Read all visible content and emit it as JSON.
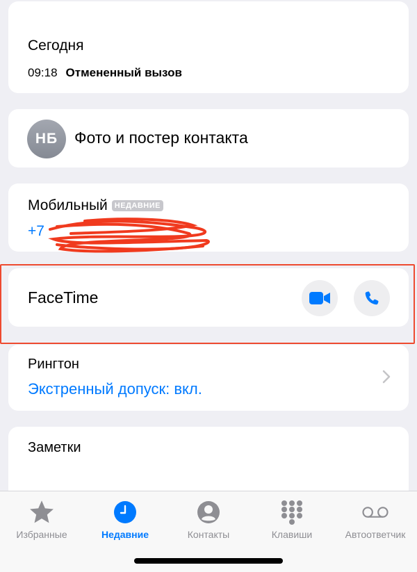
{
  "recent": {
    "date": "Сегодня",
    "time": "09:18",
    "type": "Отмененный вызов"
  },
  "contact": {
    "initials": "НБ",
    "photo_label": "Фото и постер контакта"
  },
  "mobile": {
    "label": "Мобильный",
    "badge": "НЕДАВНИЕ",
    "number": "+7"
  },
  "facetime": {
    "label": "FaceTime",
    "video_icon": "video-camera-icon",
    "audio_icon": "phone-icon"
  },
  "ringtone": {
    "label": "Рингтон",
    "value": "Экстренный допуск: вкл."
  },
  "notes": {
    "label": "Заметки"
  },
  "tabbar": {
    "tabs": [
      {
        "label": "Избранные",
        "icon": "star-icon"
      },
      {
        "label": "Недавние",
        "icon": "clock-icon",
        "active": true
      },
      {
        "label": "Контакты",
        "icon": "person-icon"
      },
      {
        "label": "Клавиши",
        "icon": "keypad-icon"
      },
      {
        "label": "Автоответчик",
        "icon": "voicemail-icon"
      }
    ]
  },
  "colors": {
    "accent": "#007aff",
    "background": "#efeff4",
    "highlight": "#ee4a2f",
    "redaction": "#f03a1e"
  }
}
